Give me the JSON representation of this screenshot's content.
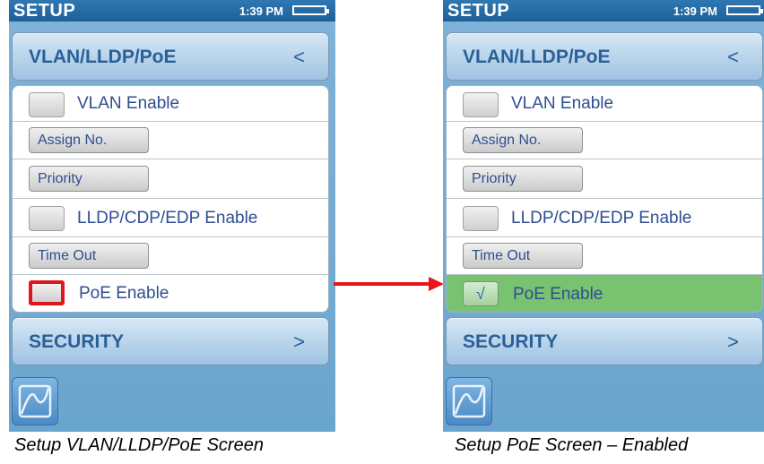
{
  "screens": [
    {
      "status": {
        "title": "SETUP",
        "time": "1:39 PM"
      },
      "section": {
        "label": "VLAN/LLDP/PoE",
        "chevron": "<"
      },
      "vlan_enable": {
        "label": "VLAN Enable",
        "checked": false
      },
      "assign_no": {
        "label": "Assign No."
      },
      "priority": {
        "label": "Priority"
      },
      "lldp_enable": {
        "label": "LLDP/CDP/EDP Enable",
        "checked": false
      },
      "time_out": {
        "label": "Time Out"
      },
      "poe_enable": {
        "label": "PoE Enable",
        "checked": false,
        "highlighted": true
      },
      "security": {
        "label": "SECURITY",
        "chevron": ">"
      },
      "caption": "Setup VLAN/LLDP/PoE Screen"
    },
    {
      "status": {
        "title": "SETUP",
        "time": "1:39 PM"
      },
      "section": {
        "label": "VLAN/LLDP/PoE",
        "chevron": "<"
      },
      "vlan_enable": {
        "label": "VLAN Enable",
        "checked": false
      },
      "assign_no": {
        "label": "Assign No."
      },
      "priority": {
        "label": "Priority"
      },
      "lldp_enable": {
        "label": "LLDP/CDP/EDP Enable",
        "checked": false
      },
      "time_out": {
        "label": "Time Out"
      },
      "poe_enable": {
        "label": "PoE Enable",
        "checked": true,
        "checkmark": "√"
      },
      "security": {
        "label": "SECURITY",
        "chevron": ">"
      },
      "caption": "Setup PoE Screen – Enabled"
    }
  ],
  "colors": {
    "arrow": "#e8161a",
    "poe_enabled_row": "#79c26f",
    "highlight": "#e0161d",
    "title_bar": "#2568a6"
  },
  "icons": {
    "battery": "battery-icon",
    "app": "graph-app-icon",
    "arrow": "right-arrow"
  }
}
